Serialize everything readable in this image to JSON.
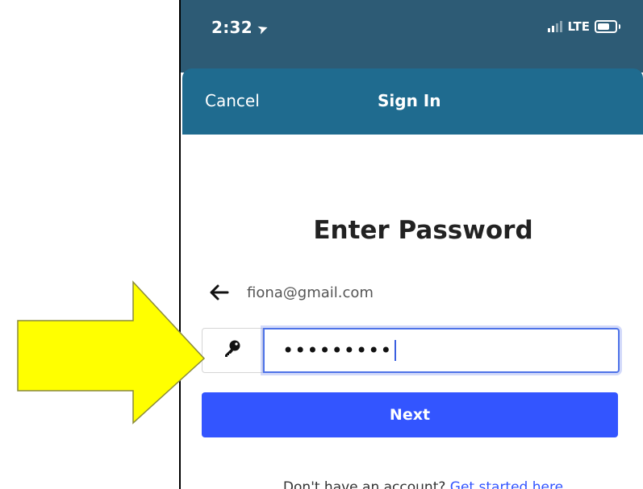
{
  "status_bar": {
    "time": "2:32",
    "location_glyph": "➤",
    "network": "LTE",
    "signal_icon": "cellular-signal-icon",
    "battery_icon": "battery-icon"
  },
  "nav": {
    "cancel_label": "Cancel",
    "title": "Sign In"
  },
  "page": {
    "heading": "Enter Password",
    "email": "fiona@gmail.com",
    "back_icon": "arrow-left-icon",
    "key_icon": "key-icon",
    "password_value": "•••••••••",
    "next_label": "Next",
    "footer_prefix": "Don't have an account? ",
    "footer_link": "Get started here"
  },
  "annotation": {
    "arrow_color": "#ffff00",
    "arrow_outline": "#8a8a3a"
  },
  "colors": {
    "status_bar_bg": "#2d5b75",
    "nav_bar_bg": "#1f6b8f",
    "primary_button": "#3355ff",
    "focus_border": "#4e73e8"
  }
}
